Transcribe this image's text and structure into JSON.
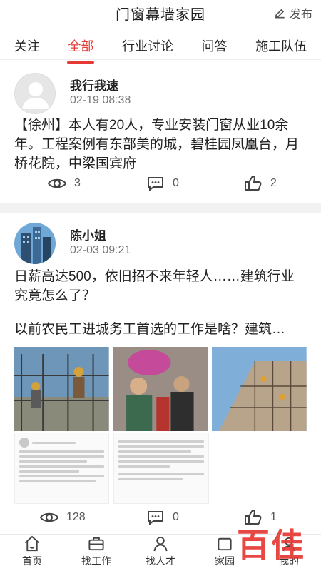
{
  "header": {
    "title": "门窗幕墙家园",
    "publish_label": "发布"
  },
  "tabs": [
    {
      "label": "关注"
    },
    {
      "label": "全部",
      "active": true
    },
    {
      "label": "行业讨论"
    },
    {
      "label": "问答"
    },
    {
      "label": "施工队伍"
    }
  ],
  "posts": [
    {
      "author": "我行我速",
      "time": "02-19 08:38",
      "content": "【徐州】本人有20人，专业安装门窗从业10余年。工程案例有东部美的城，碧桂园凤凰台，月桥花院，中梁国宾府",
      "views": "3",
      "comments": "0",
      "likes": "2"
    },
    {
      "author": "陈小姐",
      "time": "02-03 09:21",
      "content_line1": "日薪高达500，依旧招不来年轻人……建筑行业究竟怎么了？",
      "content_line2": "以前农民工进城务工首选的工作是啥？建筑…",
      "views": "128",
      "comments": "0",
      "likes": "1"
    }
  ],
  "nav": [
    {
      "label": "首页",
      "icon": "home-icon"
    },
    {
      "label": "找工作",
      "icon": "briefcase-icon"
    },
    {
      "label": "找人才",
      "icon": "person-icon"
    },
    {
      "label": "家园",
      "icon": "community-icon"
    },
    {
      "label": "我的",
      "icon": "profile-icon"
    }
  ],
  "watermark": "百佳",
  "colors": {
    "accent": "#e53935"
  }
}
